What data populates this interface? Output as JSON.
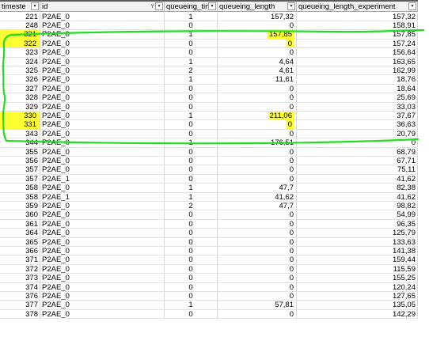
{
  "headers": {
    "timestep": "timeste",
    "id": "id",
    "queueing_time": "queueing_tin",
    "queueing_length": "queueing_length",
    "queueing_length_experimental": "queueing_length_experiment"
  },
  "filter_glyph": "Y",
  "dropdown_glyph": "▾",
  "rows": [
    {
      "t": "221",
      "id": "P2AE_0",
      "qt": "1",
      "ql": "157,32",
      "qle": "157,32"
    },
    {
      "t": "248",
      "id": "P2AE_0",
      "qt": "0",
      "ql": "0",
      "qle": "158,91"
    },
    {
      "t": "321",
      "id": "P2AE_0",
      "qt": "1",
      "ql": "157,85",
      "qle": "157,85"
    },
    {
      "t": "322",
      "id": "P2AE_0",
      "qt": "0",
      "ql": "0",
      "qle": "157,24"
    },
    {
      "t": "323",
      "id": "P2AE_0",
      "qt": "0",
      "ql": "0",
      "qle": "156,64"
    },
    {
      "t": "324",
      "id": "P2AE_0",
      "qt": "1",
      "ql": "4,64",
      "qle": "163,65"
    },
    {
      "t": "325",
      "id": "P2AE_0",
      "qt": "2",
      "ql": "4,61",
      "qle": "162,99"
    },
    {
      "t": "326",
      "id": "P2AE_0",
      "qt": "1",
      "ql": "11,61",
      "qle": "18,76"
    },
    {
      "t": "327",
      "id": "P2AE_0",
      "qt": "0",
      "ql": "0",
      "qle": "18,64"
    },
    {
      "t": "328",
      "id": "P2AE_0",
      "qt": "0",
      "ql": "0",
      "qle": "25,69"
    },
    {
      "t": "329",
      "id": "P2AE_0",
      "qt": "0",
      "ql": "0",
      "qle": "33,03"
    },
    {
      "t": "330",
      "id": "P2AE_0",
      "qt": "1",
      "ql": "211,06",
      "qle": "37,67"
    },
    {
      "t": "331",
      "id": "P2AE_0",
      "qt": "0",
      "ql": "0",
      "qle": "36,63"
    },
    {
      "t": "343",
      "id": "P2AE_0",
      "qt": "0",
      "ql": "0",
      "qle": "20,79"
    },
    {
      "t": "344",
      "id": "P2AE_0",
      "qt": "1",
      "ql": "176,51",
      "qle": "0"
    },
    {
      "t": "355",
      "id": "P2AE_0",
      "qt": "0",
      "ql": "0",
      "qle": "68,79"
    },
    {
      "t": "356",
      "id": "P2AE_0",
      "qt": "0",
      "ql": "0",
      "qle": "67,71"
    },
    {
      "t": "357",
      "id": "P2AE_0",
      "qt": "0",
      "ql": "0",
      "qle": "75,11"
    },
    {
      "t": "357",
      "id": "P2AE_1",
      "qt": "0",
      "ql": "0",
      "qle": "41,62"
    },
    {
      "t": "358",
      "id": "P2AE_0",
      "qt": "1",
      "ql": "47,7",
      "qle": "82,38"
    },
    {
      "t": "358",
      "id": "P2AE_1",
      "qt": "1",
      "ql": "41,62",
      "qle": "41,62"
    },
    {
      "t": "359",
      "id": "P2AE_0",
      "qt": "2",
      "ql": "47,7",
      "qle": "98,82"
    },
    {
      "t": "360",
      "id": "P2AE_0",
      "qt": "0",
      "ql": "0",
      "qle": "54,99"
    },
    {
      "t": "361",
      "id": "P2AE_0",
      "qt": "0",
      "ql": "0",
      "qle": "96,35"
    },
    {
      "t": "364",
      "id": "P2AE_0",
      "qt": "0",
      "ql": "0",
      "qle": "125,79"
    },
    {
      "t": "365",
      "id": "P2AE_0",
      "qt": "0",
      "ql": "0",
      "qle": "133,63"
    },
    {
      "t": "366",
      "id": "P2AE_0",
      "qt": "0",
      "ql": "0",
      "qle": "141,38"
    },
    {
      "t": "371",
      "id": "P2AE_0",
      "qt": "0",
      "ql": "0",
      "qle": "159,44"
    },
    {
      "t": "372",
      "id": "P2AE_0",
      "qt": "0",
      "ql": "0",
      "qle": "115,59"
    },
    {
      "t": "373",
      "id": "P2AE_0",
      "qt": "0",
      "ql": "0",
      "qle": "155,25"
    },
    {
      "t": "374",
      "id": "P2AE_0",
      "qt": "0",
      "ql": "0",
      "qle": "120,24"
    },
    {
      "t": "376",
      "id": "P2AE_0",
      "qt": "0",
      "ql": "0",
      "qle": "127,65"
    },
    {
      "t": "377",
      "id": "P2AE_0",
      "qt": "1",
      "ql": "57,81",
      "qle": "135,05"
    },
    {
      "t": "378",
      "id": "P2AE_0",
      "qt": "0",
      "ql": "0",
      "qle": "142,29"
    }
  ],
  "highlighted_timesteps": [
    "321",
    "322",
    "330",
    "331"
  ],
  "highlighted_queueing_length": [
    "321",
    "322",
    "330",
    "331"
  ],
  "colors": {
    "highlight": "#ffff33",
    "annotation_stroke": "#22dd22",
    "header_bg": "#f2f2f2",
    "grid": "#d9d9d9"
  }
}
